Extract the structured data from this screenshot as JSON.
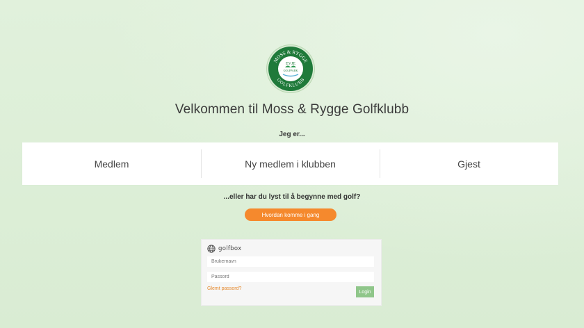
{
  "logo": {
    "top_text": "MOSS & RYGGE",
    "middle_text": "EVJE",
    "sub_text": "GOLFPARK",
    "bottom_text": "GOLFKLUBB",
    "colors": {
      "ring": "#1f7a3a",
      "inner": "#ffffff",
      "accent": "#2f9a52"
    }
  },
  "welcome_title": "Velkommen til Moss & Rygge Golfklubb",
  "role_prompt": "Jeg er...",
  "roles": [
    {
      "label": "Medlem"
    },
    {
      "label": "Ny medlem i klubben"
    },
    {
      "label": "Gjest"
    }
  ],
  "cta": {
    "text": "...eller har du lyst til å begynne med golf?",
    "button_label": "Hvordan komme i gang"
  },
  "login": {
    "brand": "golfbox",
    "brand_icon": "globe-icon",
    "username_placeholder": "Brukernavn",
    "password_placeholder": "Passord",
    "forgot_label": "Glemt passord?",
    "login_label": "Login"
  },
  "colors": {
    "background": "#deefd9",
    "cta_button": "#f5892d",
    "login_button": "#8fc68a",
    "forgot_link": "#e68a2e"
  }
}
